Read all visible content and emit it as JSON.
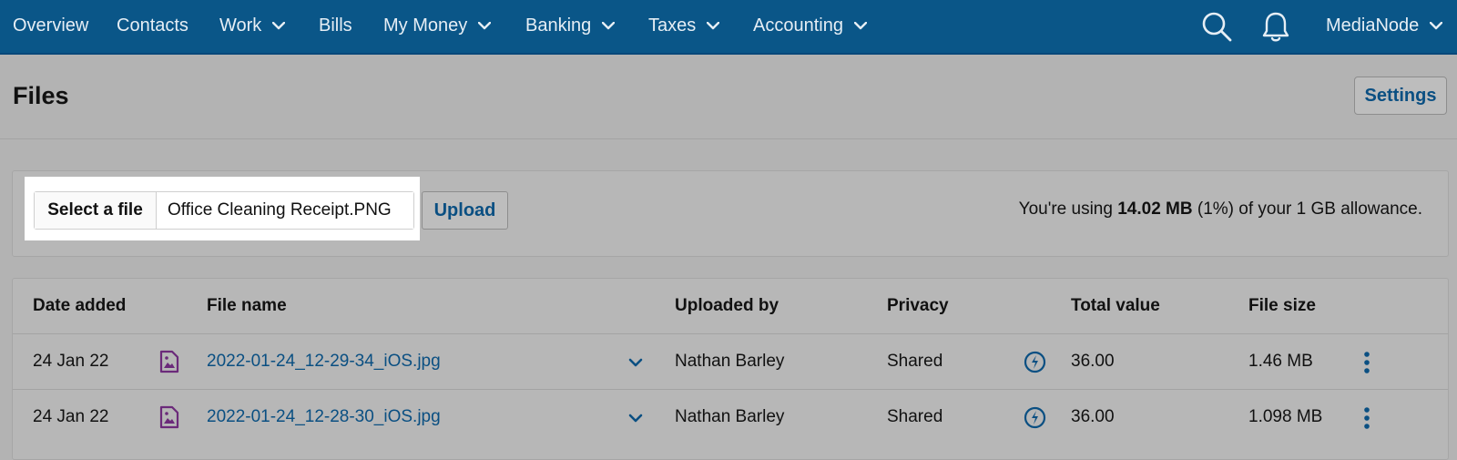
{
  "nav": {
    "items": [
      {
        "label": "Overview",
        "has_menu": false
      },
      {
        "label": "Contacts",
        "has_menu": false
      },
      {
        "label": "Work",
        "has_menu": true
      },
      {
        "label": "Bills",
        "has_menu": false
      },
      {
        "label": "My Money",
        "has_menu": true
      },
      {
        "label": "Banking",
        "has_menu": true
      },
      {
        "label": "Taxes",
        "has_menu": true
      },
      {
        "label": "Accounting",
        "has_menu": true
      }
    ],
    "search_icon": "search-icon",
    "notifications_icon": "bell-icon",
    "account_label": "MediaNode"
  },
  "page": {
    "title": "Files",
    "settings_label": "Settings"
  },
  "upload": {
    "select_label": "Select a file",
    "selected_file": "Office Cleaning Receipt.PNG",
    "upload_label": "Upload",
    "usage_prefix": "You're using ",
    "usage_amount": "14.02 MB",
    "usage_suffix": " (1%) of your 1 GB allowance."
  },
  "table": {
    "headers": {
      "date": "Date added",
      "name": "File name",
      "uploaded_by": "Uploaded by",
      "privacy": "Privacy",
      "total": "Total value",
      "size": "File size"
    },
    "rows": [
      {
        "date": "24 Jan 22",
        "name": "2022-01-24_12-29-34_iOS.jpg",
        "uploaded_by": "Nathan Barley",
        "privacy": "Shared",
        "total": "36.00",
        "size": "1.46 MB"
      },
      {
        "date": "24 Jan 22",
        "name": "2022-01-24_12-28-30_iOS.jpg",
        "uploaded_by": "Nathan Barley",
        "privacy": "Shared",
        "total": "36.00",
        "size": "1.098 MB"
      }
    ]
  },
  "colors": {
    "nav_bg": "#0a5688",
    "link": "#0a4f82",
    "file_icon": "#6b2a7a",
    "overlay_bg": "#b3b3b3"
  }
}
